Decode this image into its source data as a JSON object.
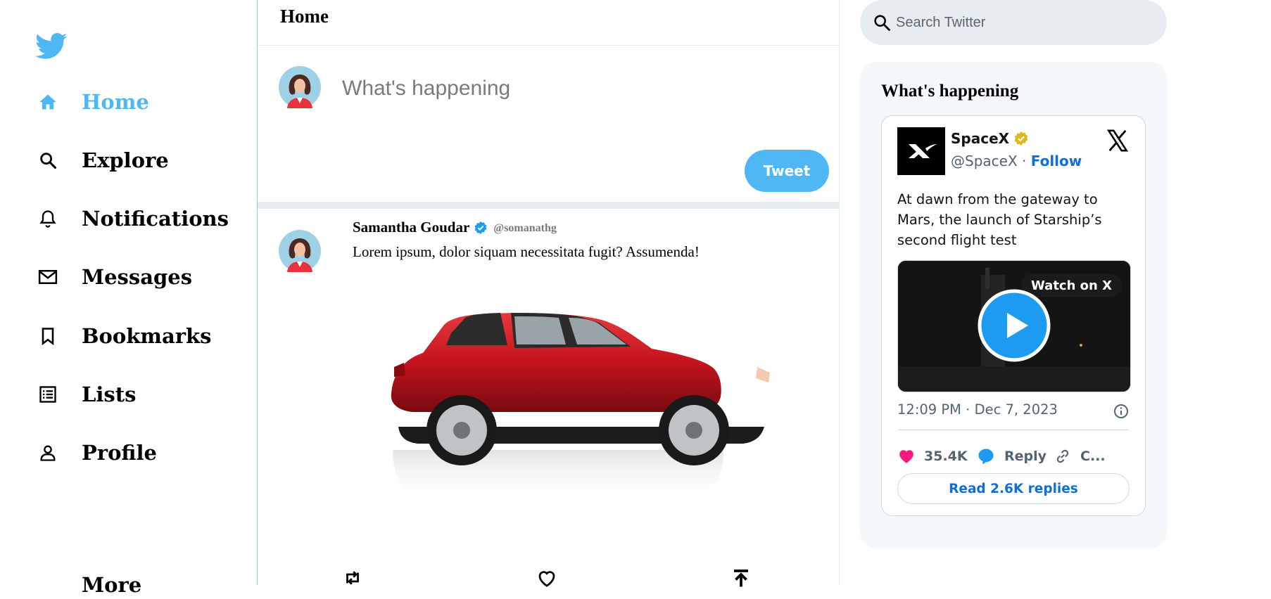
{
  "sidebar": {
    "items": [
      {
        "label": "Home",
        "icon": "home-icon",
        "active": true
      },
      {
        "label": "Explore",
        "icon": "search-icon"
      },
      {
        "label": "Notifications",
        "icon": "bell-icon"
      },
      {
        "label": "Messages",
        "icon": "mail-icon"
      },
      {
        "label": "Bookmarks",
        "icon": "bookmark-icon"
      },
      {
        "label": "Lists",
        "icon": "list-icon"
      },
      {
        "label": "Profile",
        "icon": "person-icon"
      },
      {
        "label": "More",
        "icon": "more-icon"
      }
    ]
  },
  "feed": {
    "title": "Home",
    "composer": {
      "placeholder": "What's happening",
      "tweet_label": "Tweet"
    },
    "post": {
      "name": "Samantha Goudar",
      "handle": "@somanathg",
      "text": "Lorem ipsum, dolor siquam necessitata fugit? Assumenda!",
      "image": "red-car-image"
    }
  },
  "right": {
    "search_placeholder": "Search Twitter",
    "happening_title": "What's happening",
    "embed": {
      "name": "SpaceX",
      "handle": "@SpaceX",
      "separator": " · ",
      "follow": "Follow",
      "text": "At dawn from the gateway to Mars, the launch of Starship’s second flight test",
      "watch_label": "Watch on X",
      "timestamp": "12:09 PM · Dec 7, 2023",
      "likes": "35.4K",
      "reply_label": "Reply",
      "copy_label": "C...",
      "read_replies": "Read 2.6K replies"
    }
  },
  "colors": {
    "accent": "#50b7f5",
    "link": "#0f6fd6",
    "like": "#f91880",
    "divider": "#e6ecf0"
  }
}
